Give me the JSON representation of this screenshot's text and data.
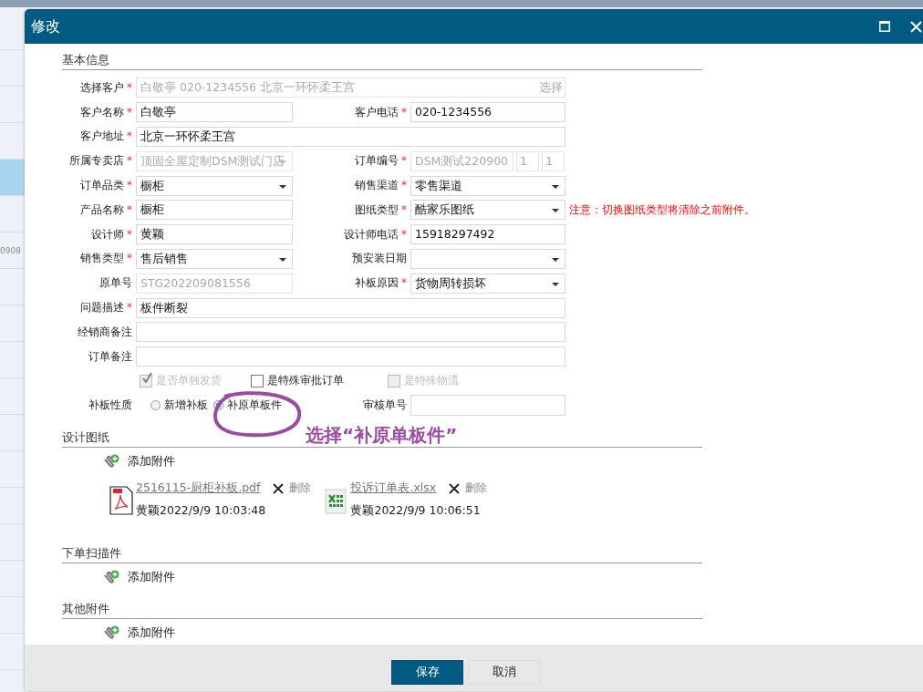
{
  "background_list": {
    "rows": [
      {
        "selected": false
      },
      {
        "selected": false
      },
      {
        "selected": false
      },
      {
        "selected": false
      },
      {
        "selected": true
      },
      {
        "selected": false
      },
      {
        "text": "0908",
        "selected": false
      },
      {
        "selected": false
      },
      {
        "selected": false
      },
      {
        "selected": false
      },
      {
        "selected": false
      },
      {
        "selected": false
      },
      {
        "selected": false
      },
      {
        "selected": false
      },
      {
        "selected": false
      },
      {
        "selected": false
      },
      {
        "selected": false
      },
      {
        "selected": false
      }
    ]
  },
  "window": {
    "title": "修改"
  },
  "basic_info": {
    "title": "基本信息",
    "rows": [
      {
        "fields": [
          {
            "label": "选择客户",
            "required_mark": "*",
            "kind": "picker",
            "value": "白敬亭 020-1234556 北京一环怀柔王宫",
            "action": "选择",
            "disabled": true
          }
        ]
      },
      {
        "fields": [
          {
            "label": "客户名称",
            "required_mark": "*",
            "kind": "text",
            "value": "白敬亭",
            "disabled": false
          },
          {
            "label": "客户电话",
            "required_mark": "*",
            "kind": "text",
            "value": "020-1234556",
            "disabled": false
          }
        ]
      },
      {
        "fields": [
          {
            "label": "客户地址",
            "required_mark": "*",
            "kind": "text",
            "value": "北京一环怀柔王宫",
            "disabled": false
          }
        ]
      },
      {
        "fields": [
          {
            "label": "所属专卖店",
            "required_mark": "*",
            "kind": "select",
            "value": "顶固全屋定制DSM测试门店",
            "disabled": true
          },
          {
            "label": "订单编号",
            "required_mark": "*",
            "kind": "order_no",
            "value": "DSM测试220900",
            "extra": [
              "1",
              "1"
            ],
            "disabled": true
          }
        ]
      },
      {
        "fields": [
          {
            "label": "订单品类",
            "required_mark": "*",
            "kind": "select",
            "value": "橱柜",
            "disabled": false
          },
          {
            "label": "销售渠道",
            "required_mark": "*",
            "kind": "select",
            "value": "零售渠道",
            "disabled": false
          }
        ]
      },
      {
        "fields": [
          {
            "label": "产品名称",
            "required_mark": "*",
            "kind": "text",
            "value": "橱柜",
            "disabled": false
          },
          {
            "label": "图纸类型",
            "required_mark": "*",
            "kind": "select",
            "value": "酷家乐图纸",
            "disabled": false
          }
        ],
        "note": "注意：切换图纸类型将清除之前附件。"
      },
      {
        "fields": [
          {
            "label": "设计师",
            "required_mark": "*",
            "kind": "text",
            "value": "黄颖",
            "disabled": false
          },
          {
            "label": "设计师电话",
            "required_mark": "*",
            "kind": "text",
            "value": "15918297492",
            "disabled": false
          }
        ]
      },
      {
        "fields": [
          {
            "label": "销售类型",
            "required_mark": "*",
            "kind": "select",
            "value": "售后销售",
            "disabled": false
          },
          {
            "label": "预安装日期",
            "kind": "select",
            "disabled": false
          }
        ]
      },
      {
        "fields": [
          {
            "label": "原单号",
            "kind": "text",
            "value": "STG202209081556",
            "disabled": true
          },
          {
            "label": "补板原因",
            "required_mark": "*",
            "kind": "select",
            "value": "货物周转损坏",
            "disabled": false
          }
        ]
      },
      {
        "fields": [
          {
            "label": "问题描述",
            "required_mark": "*",
            "kind": "text",
            "value": "板件断裂",
            "disabled": false
          }
        ]
      },
      {
        "fields": [
          {
            "label": "经销商备注",
            "kind": "text"
          }
        ]
      },
      {
        "fields": [
          {
            "label": "订单备注",
            "kind": "text"
          }
        ]
      }
    ],
    "checkboxes": [
      {
        "label": "是否单独发货",
        "checked": true,
        "disabled": true
      },
      {
        "label": "是特殊审批订单",
        "checked": false,
        "disabled": false
      },
      {
        "label": "是特殊物流",
        "checked": false,
        "disabled": true
      }
    ],
    "board_nature": {
      "label": "补板性质",
      "options": [
        {
          "label": "新增补板",
          "selected": false
        },
        {
          "label": "补原单板件",
          "selected": true
        }
      ]
    },
    "review_no": {
      "label": "审核单号"
    }
  },
  "annotation": {
    "text": "选择“补原单板件”"
  },
  "attachment_sections": [
    {
      "title": "设计图纸",
      "add": "添加附件",
      "files": [
        {
          "kind": "pdf",
          "name": "2516115-厨柜补板.pdf",
          "delete": "删除",
          "meta": "黄颖2022/9/9 10:03:48"
        },
        {
          "kind": "xlsx",
          "name": "投诉订单表.xlsx",
          "delete": "删除",
          "meta": "黄颖2022/9/9 10:06:51"
        }
      ]
    },
    {
      "title": "下单扫描件",
      "add": "添加附件"
    },
    {
      "title": "其他附件",
      "add": "添加附件"
    }
  ],
  "buttons": [
    {
      "label": "保存",
      "kind": "primary"
    },
    {
      "label": "取消",
      "kind": "default"
    }
  ]
}
